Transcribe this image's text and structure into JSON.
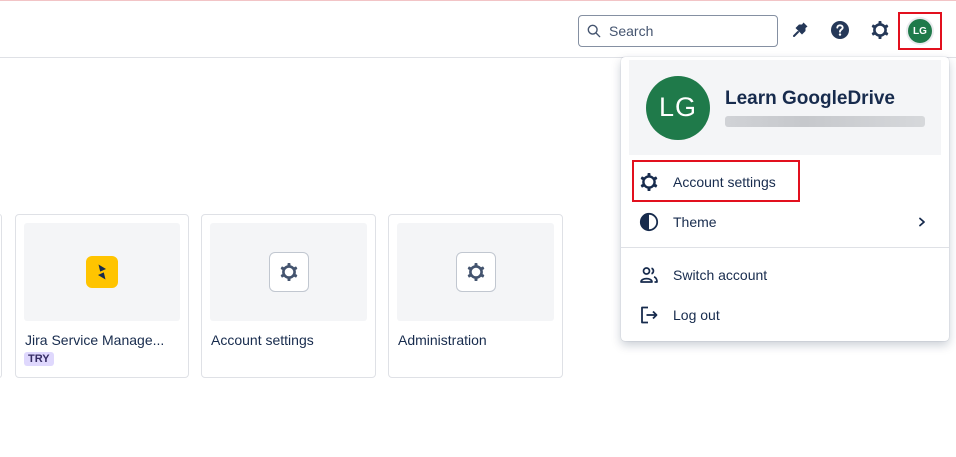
{
  "header": {
    "search": {
      "placeholder": "Search"
    },
    "icons": [
      "notification-icon",
      "help-icon",
      "settings-icon"
    ],
    "avatar_initials": "LG"
  },
  "cards": [
    {
      "name": "Jira Service Manage...",
      "badge": "TRY",
      "icon": "jira-service-management-logo"
    },
    {
      "name": "Account settings",
      "icon": "gear-icon"
    },
    {
      "name": "Administration",
      "icon": "gear-icon"
    }
  ],
  "profile_menu": {
    "avatar_initials": "LG",
    "name": "Learn GoogleDrive",
    "items": [
      {
        "label": "Account settings",
        "icon": "gear-icon"
      },
      {
        "label": "Theme",
        "icon": "theme-icon"
      },
      {
        "label": "Switch account",
        "icon": "people-icon"
      },
      {
        "label": "Log out",
        "icon": "logout-icon"
      }
    ]
  },
  "colors": {
    "avatar": "#1f7a4a",
    "highlight": "#e2101e",
    "jsm_logo": "#ffc400",
    "try_badge": "#dfd8fd"
  }
}
